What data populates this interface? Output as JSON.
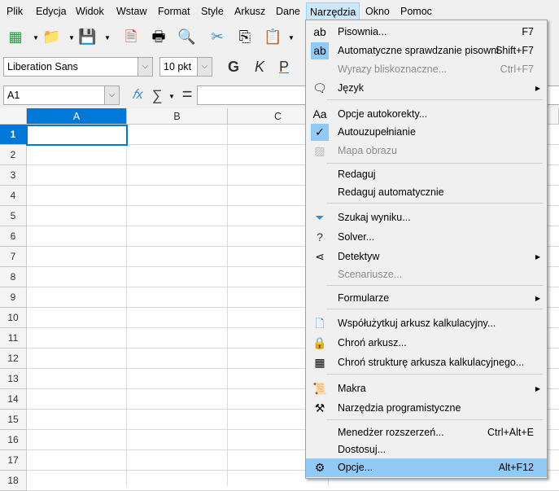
{
  "menubar": {
    "items": [
      "Plik",
      "Edycja",
      "Widok",
      "Wstaw",
      "Format",
      "Style",
      "Arkusz",
      "Dane",
      "Narzędzia",
      "Okno",
      "Pomoc"
    ],
    "active": "Narzędzia"
  },
  "toolbar": {
    "font_name": "Liberation Sans",
    "font_size": "10 pkt",
    "bold": "G",
    "italic": "K",
    "underline": "P"
  },
  "formula_bar": {
    "cell_ref": "A1",
    "fx": "𝑓x",
    "sum": "∑",
    "equals": "=",
    "value": ""
  },
  "grid": {
    "columns": [
      "A",
      "B",
      "C"
    ],
    "rows": [
      "1",
      "2",
      "3",
      "4",
      "5",
      "6",
      "7",
      "8",
      "9",
      "10",
      "11",
      "12",
      "13",
      "14",
      "15",
      "16",
      "17",
      "18"
    ],
    "selected_cell": "A1",
    "accent": "#0078d7"
  },
  "menu": {
    "items": [
      {
        "label": "Pisownia...",
        "shortcut": "F7",
        "icon": "spelling-icon"
      },
      {
        "label": "Automatyczne sprawdzanie pisowni",
        "shortcut": "Shift+F7",
        "icon": "autospell-icon",
        "checked": true
      },
      {
        "label": "Wyrazy bliskoznaczne...",
        "shortcut": "Ctrl+F7",
        "disabled": true
      },
      {
        "label": "Język",
        "submenu": true,
        "icon": "language-icon"
      },
      {
        "label": "Opcje autokorekty...",
        "icon": "autocorrect-icon"
      },
      {
        "label": "Autouzupełnianie",
        "icon": "check-icon",
        "checked": true
      },
      {
        "label": "Mapa obrazu",
        "icon": "image-map-icon",
        "disabled": true
      },
      {
        "label": "Redaguj"
      },
      {
        "label": "Redaguj automatycznie"
      },
      {
        "label": "Szukaj wyniku...",
        "icon": "goal-seek-icon"
      },
      {
        "label": "Solver...",
        "icon": "solver-icon"
      },
      {
        "label": "Detektyw",
        "submenu": true,
        "icon": "detective-icon"
      },
      {
        "label": "Scenariusze...",
        "disabled": true
      },
      {
        "label": "Formularze",
        "submenu": true
      },
      {
        "label": "Współużytkuj arkusz kalkulacyjny...",
        "icon": "share-icon"
      },
      {
        "label": "Chroń arkusz...",
        "icon": "lock-icon"
      },
      {
        "label": "Chroń strukturę arkusza kalkulacyjnego...",
        "icon": "protect-structure-icon"
      },
      {
        "label": "Makra",
        "submenu": true,
        "icon": "macro-icon"
      },
      {
        "label": "Narzędzia programistyczne",
        "icon": "developer-tools-icon"
      },
      {
        "label": "Menedżer rozszerzeń...",
        "shortcut": "Ctrl+Alt+E"
      },
      {
        "label": "Dostosuj..."
      },
      {
        "label": "Opcje...",
        "shortcut": "Alt+F12",
        "icon": "gear-icon",
        "highlighted": true
      }
    ]
  }
}
